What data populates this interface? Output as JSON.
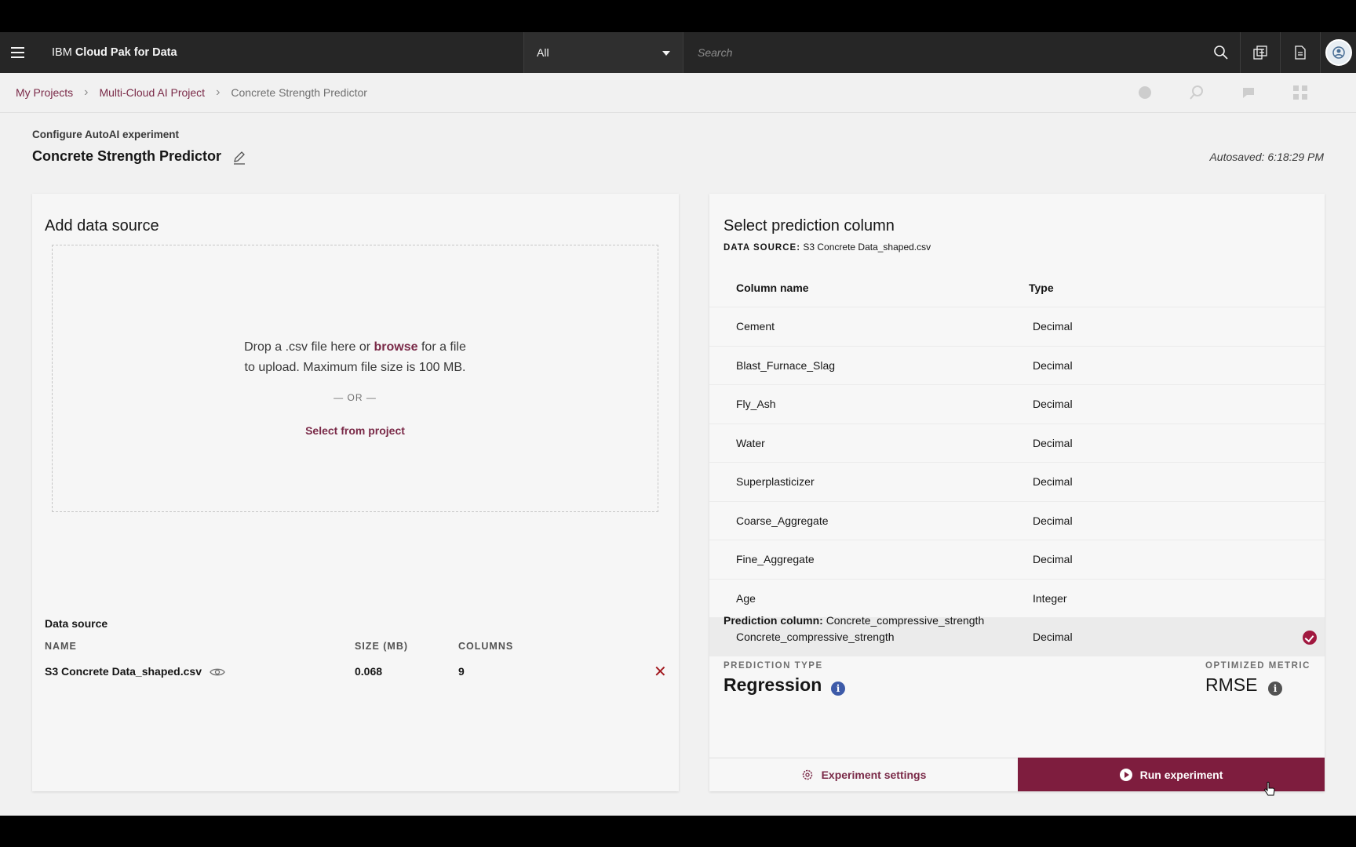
{
  "topbar": {
    "brand_prefix": "IBM",
    "brand_name": "Cloud Pak for Data",
    "scope_value": "All",
    "search_placeholder": "Search"
  },
  "breadcrumb": [
    {
      "label": "My Projects"
    },
    {
      "label": "Multi-Cloud AI Project"
    },
    {
      "label": "Concrete Strength Predictor"
    }
  ],
  "header": {
    "subtitle": "Configure AutoAI experiment",
    "title": "Concrete Strength Predictor",
    "autosaved": "Autosaved: 6:18:29 PM"
  },
  "data_panel": {
    "title": "Add data source",
    "drop_text_1": "Drop a .csv file here or",
    "browse": "browse",
    "drop_text_2": "for a file",
    "drop_text_3": "to upload. Maximum file size is 100 MB.",
    "or": "— OR —",
    "select_from_project": "Select from project",
    "data_source_title": "Data source",
    "headers": {
      "name": "NAME",
      "size": "SIZE (MB)",
      "columns": "COLUMNS"
    },
    "file": {
      "name": "S3 Concrete Data_shaped.csv",
      "size": "0.068",
      "columns": "9"
    },
    "remove": "✕"
  },
  "prediction_panel": {
    "title": "Select prediction column",
    "source_label": "DATA SOURCE:",
    "source_value": "S3 Concrete Data_shaped.csv",
    "col_header_name": "Column name",
    "col_header_type": "Type",
    "rows": [
      {
        "name": "Cement",
        "type": "Decimal"
      },
      {
        "name": "Blast_Furnace_Slag",
        "type": "Decimal"
      },
      {
        "name": "Fly_Ash",
        "type": "Decimal"
      },
      {
        "name": "Water",
        "type": "Decimal"
      },
      {
        "name": "Superplasticizer",
        "type": "Decimal"
      },
      {
        "name": "Coarse_Aggregate",
        "type": "Decimal"
      },
      {
        "name": "Fine_Aggregate",
        "type": "Decimal"
      },
      {
        "name": "Age",
        "type": "Integer"
      },
      {
        "name": "Concrete_compressive_strength",
        "type": "Decimal"
      }
    ],
    "selected_index": 8,
    "prediction_label": "Prediction column:",
    "prediction_value": "Concrete_compressive_strength",
    "prediction_type_label": "PREDICTION TYPE",
    "prediction_type": "Regression",
    "metric_label": "OPTIMIZED METRIC",
    "metric": "RMSE",
    "info_glyph": "i",
    "settings_button": "Experiment settings",
    "run_button": "Run experiment"
  },
  "colors": {
    "accent": "#7e1d3e",
    "link": "#7a2a48",
    "topbar": "#262626"
  }
}
